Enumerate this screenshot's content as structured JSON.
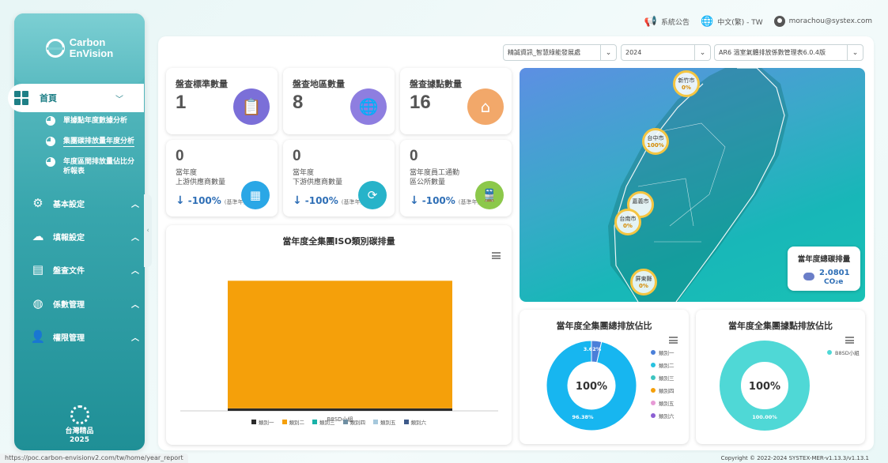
{
  "brand": {
    "logo_line1": "Carbon",
    "logo_line2": "EnVision",
    "badge_line1": "台灣精品",
    "badge_line2": "2025"
  },
  "topbar": {
    "announcement": "系統公告",
    "language": "中文(繁) - TW",
    "user_email": "morachou@systex.com"
  },
  "sidebar": {
    "home": {
      "label": "首頁",
      "icon": "dashboard-grid-icon"
    },
    "subitems": [
      {
        "label": "單據點年度數據分析",
        "icon": "pie-chart-icon"
      },
      {
        "label": "集團碳排放量年度分析",
        "icon": "pie-chart-icon",
        "active": true
      },
      {
        "label": "年度區間排放量佔比分析報表",
        "line1": "年度區間排放量佔比分",
        "line2": "析報表",
        "icon": "pie-chart-icon"
      }
    ],
    "items": [
      {
        "label": "基本設定",
        "icon": "gear-icon"
      },
      {
        "label": "填報設定",
        "icon": "co2-cloud-icon"
      },
      {
        "label": "盤查文件",
        "icon": "documents-icon"
      },
      {
        "label": "係數管理",
        "icon": "globe-icon"
      },
      {
        "label": "權限管理",
        "icon": "user-add-icon"
      }
    ]
  },
  "filters": {
    "organization": "精誠資訊_智慧綠能發展處",
    "year": "2024",
    "factor_table": "AR6 溫室氣體排放係數管理表6.0.4版"
  },
  "stats": [
    {
      "title": "盤查標準數量",
      "value": "1",
      "icon": "standards-icon",
      "color": "#7b6fd8"
    },
    {
      "title": "盤查地區數量",
      "value": "8",
      "icon": "globe-pin-icon",
      "color": "#8e7ee0"
    },
    {
      "title": "盤查據點數量",
      "value": "16",
      "icon": "location-pin-icon",
      "color": "#f2a86a"
    }
  ],
  "mini_stats": [
    {
      "value": "0",
      "label_line1": "當年度",
      "label_line2": "上游供應商數量",
      "pct": "-100%",
      "base": "(基準年)",
      "icon": "supplier-icon",
      "color": "#2aa7e6"
    },
    {
      "value": "0",
      "label_line1": "當年度",
      "label_line2": "下游供應商數量",
      "pct": "-100%",
      "base": "(基準年)",
      "icon": "cycle-icon",
      "color": "#27b3c9"
    },
    {
      "value": "0",
      "label_line1": "當年度員工通勤",
      "label_line2": "區公所數量",
      "pct": "-100%",
      "base": "(基準年)",
      "icon": "train-icon",
      "color": "#8cc84b"
    }
  ],
  "iso_chart": {
    "title": "當年度全集團ISO類別碳排量",
    "legend": [
      {
        "name": "類別一",
        "color": "#2b2b2b"
      },
      {
        "name": "類別二",
        "color": "#f5a00a"
      },
      {
        "name": "類別三",
        "color": "#19b2a8"
      },
      {
        "name": "類別四",
        "color": "#6f8fa3"
      },
      {
        "name": "類別五",
        "color": "#a6c8dc"
      },
      {
        "name": "類別六",
        "color": "#3e5a8a"
      }
    ]
  },
  "map": {
    "cities": [
      {
        "name": "新竹市",
        "pct": "0%"
      },
      {
        "name": "台中市",
        "pct": "100%"
      },
      {
        "name": "嘉義市",
        "pct": ""
      },
      {
        "name": "台南市",
        "pct": "0%"
      },
      {
        "name": "屏東縣",
        "pct": "0%"
      }
    ],
    "total_title": "當年度總碳排量",
    "total_value": "2.0801",
    "total_unit": "CO₂e"
  },
  "donut_total": {
    "title": "當年度全集團總排放佔比",
    "center": "100%",
    "slice_small_label": "3.62%",
    "slice_large_label": "96.38%",
    "legend": [
      {
        "name": "類別一",
        "color": "#4a7fd9"
      },
      {
        "name": "類別二",
        "color": "#27c2e0"
      },
      {
        "name": "類別三",
        "color": "#3ec4c0"
      },
      {
        "name": "類別四",
        "color": "#f5a00a"
      },
      {
        "name": "類別五",
        "color": "#e79ad6"
      },
      {
        "name": "類別六",
        "color": "#8c5fd3"
      }
    ]
  },
  "donut_site": {
    "title": "當年度全集團據點排放佔比",
    "center": "100%",
    "slice_label": "100.00%",
    "legend": [
      {
        "name": "B8SD小組",
        "color": "#4fd8d6"
      }
    ]
  },
  "chart_data": [
    {
      "type": "bar",
      "title": "當年度全集團ISO類別碳排量",
      "categories": [
        "B8SD小組"
      ],
      "series": [
        {
          "name": "類別一",
          "values": [
            0.04
          ]
        },
        {
          "name": "類別二",
          "values": [
            2.04
          ]
        },
        {
          "name": "類別三",
          "values": [
            0
          ]
        },
        {
          "name": "類別四",
          "values": [
            0
          ]
        },
        {
          "name": "類別五",
          "values": [
            0
          ]
        },
        {
          "name": "類別六",
          "values": [
            0
          ]
        }
      ],
      "stacked": true
    },
    {
      "type": "pie",
      "title": "當年度全集團總排放佔比",
      "labels": [
        "類別一",
        "類別二"
      ],
      "values": [
        3.62,
        96.38
      ]
    },
    {
      "type": "pie",
      "title": "當年度全集團據點排放佔比",
      "labels": [
        "B8SD小組"
      ],
      "values": [
        100
      ]
    }
  ],
  "status_url": "https://poc.carbon-envisionv2.com/tw/home/year_report",
  "copyright": "Copyright © 2022-2024 SYSTEX-MER-v1.13.3/v1.13.1"
}
